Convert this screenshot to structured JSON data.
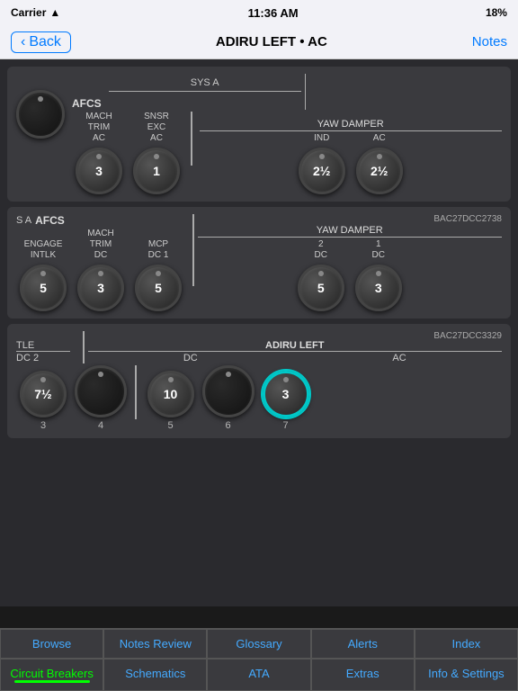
{
  "statusBar": {
    "carrier": "Carrier",
    "time": "11:36 AM",
    "battery": "18%",
    "wifi": true
  },
  "navBar": {
    "backLabel": "Back",
    "title": "ADIRU LEFT • AC",
    "notesLabel": "Notes"
  },
  "panels": [
    {
      "id": "panel1",
      "badge": "",
      "topLabel": "AFCS",
      "sysALabel": "SYS A",
      "groups": [
        {
          "label": "MACH\nTRIM\nAC",
          "value": "3",
          "number": null,
          "selected": false,
          "dark": false
        },
        {
          "label": "SNSR\nEXC\nAC",
          "value": "1",
          "number": null,
          "selected": false,
          "dark": false
        }
      ],
      "yawDamper": {
        "label": "YAW\nDAMPER",
        "sub": [
          {
            "label": "IND",
            "value": "2½",
            "number": null,
            "selected": false
          },
          {
            "label": "AC",
            "value": "2½",
            "number": null,
            "selected": false
          }
        ]
      },
      "darkKnob": true
    },
    {
      "id": "panel2",
      "badge": "BAC27DCC2738",
      "topLabel": "AFCS",
      "sysALabel": "S A",
      "groups": [
        {
          "label": "ENGAGE\nINTLK",
          "value": "5",
          "number": null,
          "selected": false,
          "dark": false
        },
        {
          "label": "MACH\nTRIM\nDC",
          "value": "3",
          "number": null,
          "selected": false,
          "dark": false
        },
        {
          "label": "MCP\nDC 1",
          "value": "5",
          "number": null,
          "selected": false,
          "dark": false
        }
      ],
      "yawDamper": {
        "label": "YAW\nDAMPER",
        "sub": [
          {
            "label": "2\nDC",
            "value": "5",
            "number": null,
            "selected": false
          },
          {
            "label": "1\nDC",
            "value": "3",
            "number": null,
            "selected": false
          }
        ]
      }
    },
    {
      "id": "panel3",
      "badge": "BAC27DCC3329",
      "tleLabel": "TLE",
      "dc2Label": "DC 2",
      "adiruLabel": "ADIRU\nLEFT",
      "groups": [
        {
          "label": "DC 2",
          "value": "7½",
          "number": "3",
          "selected": false,
          "dark": false
        },
        {
          "label": "",
          "value": "",
          "number": "4",
          "selected": false,
          "dark": true
        },
        {
          "label": "DC",
          "value": "10",
          "number": "5",
          "selected": false,
          "dark": false
        },
        {
          "label": "",
          "value": "",
          "number": "6",
          "selected": false,
          "dark": true
        },
        {
          "label": "AC",
          "value": "3",
          "number": "7",
          "selected": true,
          "dark": false
        }
      ]
    }
  ],
  "bottomTabs": {
    "row1": [
      {
        "label": "Browse",
        "active": false,
        "highlighted": false
      },
      {
        "label": "Notes Review",
        "active": false,
        "highlighted": false
      },
      {
        "label": "Glossary",
        "active": false,
        "highlighted": false
      },
      {
        "label": "Alerts",
        "active": false,
        "highlighted": false
      },
      {
        "label": "Index",
        "active": false,
        "highlighted": false
      }
    ],
    "row2": [
      {
        "label": "Circuit Breakers",
        "active": true,
        "highlighted": true
      },
      {
        "label": "Schematics",
        "active": false,
        "highlighted": false
      },
      {
        "label": "ATA",
        "active": false,
        "highlighted": false
      },
      {
        "label": "Extras",
        "active": false,
        "highlighted": false
      },
      {
        "label": "Info & Settings",
        "active": false,
        "highlighted": false
      }
    ]
  }
}
